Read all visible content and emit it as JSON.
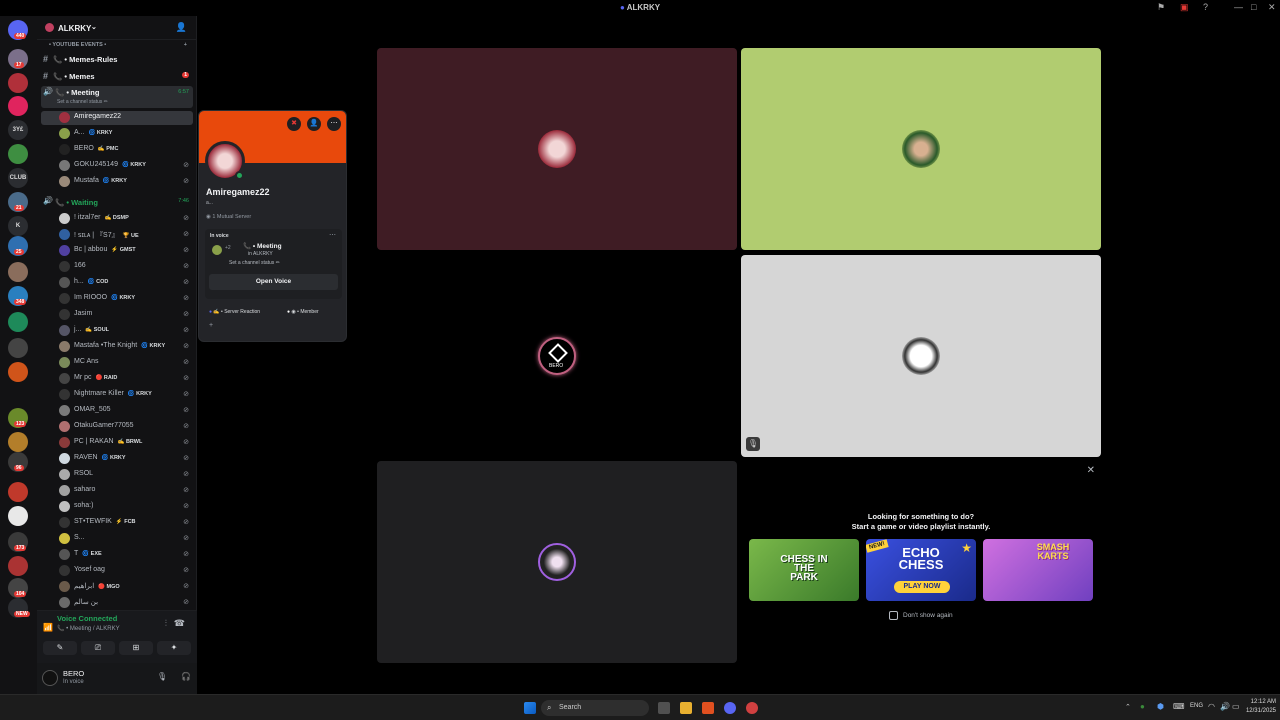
{
  "window": {
    "title": "ALKRKY"
  },
  "servers": [
    {
      "badge": "440",
      "color": "#5865f2"
    },
    {
      "badge": "17",
      "color": "#7b6f8a"
    },
    {
      "badge": "",
      "color": "#b0303a"
    },
    {
      "badge": "",
      "color": "#e0245e"
    },
    {
      "label": "3Y£",
      "badge": "",
      "color": "#2b2d31"
    },
    {
      "badge": "",
      "color": "#3e8e41"
    },
    {
      "label": "CLUB",
      "badge": "",
      "color": "#2b2d31"
    },
    {
      "badge": "21",
      "color": "#4a6b8a"
    },
    {
      "label": "K",
      "badge": "",
      "color": "#2b2d31"
    },
    {
      "badge": "25",
      "color": "#2f6fb0"
    },
    {
      "badge": "",
      "color": "#8a6d5c"
    },
    {
      "badge": "348",
      "color": "#2a7fbf"
    },
    {
      "badge": "",
      "color": "#1e8a5a"
    },
    {
      "badge": "",
      "color": "#444"
    },
    {
      "badge": "",
      "color": "#d0541a"
    },
    {
      "badge": "123",
      "color": "#6a8a2a"
    },
    {
      "badge": "",
      "color": "#b37e2a"
    },
    {
      "badge": "96",
      "color": "#3a3a3a"
    },
    {
      "badge": "",
      "color": "#c0392b"
    },
    {
      "badge": "",
      "color": "#e8e8e8"
    },
    {
      "badge": "173",
      "color": "#3a3a3a"
    },
    {
      "badge": "",
      "color": "#a33"
    },
    {
      "badge": "104",
      "color": "#444"
    },
    {
      "badge": "NEW",
      "color": "#2b2d31"
    }
  ],
  "server": {
    "name": "ALKRKY",
    "categories": [
      {
        "label": "• YOUTUBE EVENTS •"
      }
    ],
    "channels": [
      {
        "label": "📞 • Memes-Rules",
        "badge": ""
      },
      {
        "label": "📞 • Memes",
        "badge": "1"
      }
    ],
    "meeting": {
      "label": "📞 • Meeting",
      "time": "6:57",
      "status": "Set a channel status ✏"
    },
    "meeting_members": [
      {
        "name": "Amiregamez22",
        "tag": "",
        "selected": true,
        "color": "#a03040"
      },
      {
        "name": "A...",
        "tag": "🌀 KRKY",
        "color": "#8aa04a"
      },
      {
        "name": "BERO",
        "tag": "✍ PMC",
        "color": "#222"
      },
      {
        "name": "GOKU245149",
        "tag": "🌀 KRKY",
        "color": "#777"
      },
      {
        "name": "Mustafa",
        "tag": "🌀 KRKY",
        "color": "#9a8a7a"
      }
    ],
    "waiting": {
      "label": "📞 • Waiting",
      "time": "7:46"
    },
    "waiting_members": [
      {
        "name": "! itzal7er",
        "tag": "✍ DSMP",
        "color": "#ccc"
      },
      {
        "name": "! ꜱɪʟᴀ | 『S7』",
        "tag": "🏆 UE",
        "color": "#3060a0"
      },
      {
        "name": "Bc | abbou",
        "tag": "⚡ GMST",
        "color": "#5040a0"
      },
      {
        "name": "166",
        "tag": "",
        "color": "#333"
      },
      {
        "name": "h...",
        "tag": "🌀 COD",
        "color": "#555"
      },
      {
        "name": "Im RIOOO",
        "tag": "🌀 KRKY",
        "color": "#333"
      },
      {
        "name": "Jasim",
        "tag": "",
        "color": "#333"
      },
      {
        "name": "j...",
        "tag": "✍ SOUL",
        "color": "#556"
      },
      {
        "name": "Mastafa •The Knight",
        "tag": "🌀 KRKY",
        "color": "#8a7a6a"
      },
      {
        "name": "MC Ans",
        "tag": "",
        "color": "#7a8a5a"
      },
      {
        "name": "Mr pc",
        "tag": "🔴 RAID",
        "color": "#444"
      },
      {
        "name": "Nightmare Killer",
        "tag": "🌀 KRKY",
        "color": "#333"
      },
      {
        "name": "OMAR_505",
        "tag": "",
        "color": "#7a7a7a"
      },
      {
        "name": "OtakuGamer77055",
        "tag": "",
        "color": "#b07070"
      },
      {
        "name": "PC | RAKAN",
        "tag": "✍ BRWL",
        "color": "#8a3a3a"
      },
      {
        "name": "RAVEN",
        "tag": "🌀 KRKY",
        "color": "#cfd8e0"
      },
      {
        "name": "RSOL",
        "tag": "",
        "color": "#aaa"
      },
      {
        "name": "saharo",
        "tag": "",
        "color": "#a0a0a0"
      },
      {
        "name": "soha:)",
        "tag": "",
        "color": "#c0c0c0"
      },
      {
        "name": "ST•TEWFIK",
        "tag": "⚡ FCB",
        "color": "#333"
      },
      {
        "name": "S...",
        "tag": "",
        "color": "#d0c040"
      },
      {
        "name": "T",
        "tag": "🌀 EXE",
        "color": "#555"
      },
      {
        "name": "Yosef oag",
        "tag": "",
        "color": "#333"
      },
      {
        "name": "ابراهيم",
        "tag": "🔴 MGO",
        "color": "#6a5a4a"
      },
      {
        "name": "بن سالم",
        "tag": "",
        "color": "#6a6a6a"
      }
    ]
  },
  "voice": {
    "status": "Voice Connected",
    "location": "📞 • Meeting / ALKRKY"
  },
  "user": {
    "name": "BERO",
    "status": "In voice"
  },
  "popout": {
    "username": "Amiregamez22",
    "handle": "a...",
    "mutual": "1 Mutual Server",
    "in_voice_label": "In voice",
    "channel": "📞 • Meeting",
    "server": "in ALKRKY",
    "channel_status": "Set a channel status ✏",
    "open_voice": "Open Voice",
    "roles": [
      "Server Reaction",
      "Member"
    ]
  },
  "tiles": [
    {
      "name": "amiregamez22-tile",
      "bg": "#3f1c24"
    },
    {
      "name": "green-tile",
      "bg": "#b1cc70"
    },
    {
      "name": "bero-tile",
      "bg": "#000000",
      "label": "BERO"
    },
    {
      "name": "white-tile",
      "bg": "#d6d6d6"
    },
    {
      "name": "dark-tile",
      "bg": "#1f1f21"
    }
  ],
  "activity": {
    "headline": "Looking for something to do?",
    "sub": "Start a game or video playlist instantly.",
    "games": [
      {
        "title": "CHESS IN THE PARK",
        "bg": "#5a9a3a"
      },
      {
        "title": "ECHO CHESS",
        "badge": "NEW!",
        "cta": "PLAY NOW",
        "bg": "#2e3fbf"
      },
      {
        "title": "SMASH KARTS",
        "bg": "#b04ad0"
      }
    ],
    "dont_show": "Don't show again"
  },
  "taskbar": {
    "search": "Search",
    "lang": "ENG",
    "time": "12:12 AM",
    "date": "12/31/2025"
  }
}
